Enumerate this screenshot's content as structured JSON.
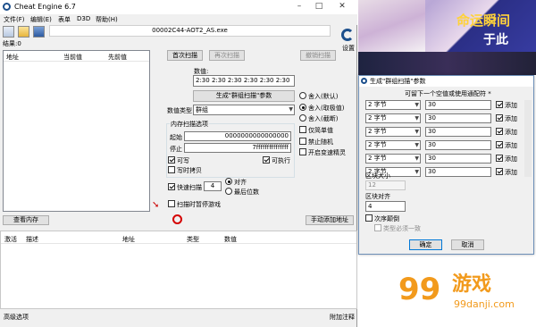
{
  "window": {
    "title": "Cheat Engine 6.7",
    "process": "00002C44-AOT2_AS.exe",
    "found_label": "结果:0"
  },
  "menu": [
    "文件(F)",
    "编辑(E)",
    "表单",
    "D3D",
    "帮助(H)"
  ],
  "results_headers": [
    "地址",
    "当前值",
    "先前值"
  ],
  "buttons": {
    "first_scan": "首次扫描",
    "next_scan": "再次扫描",
    "undo_scan": "撤销扫描",
    "settings": "设置",
    "array_params": "生成\"群组扫描\"参数",
    "view_memory": "查看内存",
    "add_address": "手动添加地址"
  },
  "value": {
    "label": "数值:",
    "text": "2:30 2:30 2:30 2:30 2:30 2:30"
  },
  "value_type": {
    "label": "数值类型",
    "selected": "群组"
  },
  "round_options": [
    "舍入(默认)",
    "舍入(取极值)",
    "舍入(截断)"
  ],
  "extra_options": [
    "仅简单值",
    "禁止随机",
    "开启变速精灵"
  ],
  "memory_options": {
    "title": "内存扫描选项",
    "start_label": "起始",
    "start_value": "0000000000000000",
    "stop_label": "停止",
    "stop_value": "7fffffffffffffff",
    "writable": "可写",
    "executable": "可执行",
    "copy_on_write": "写时拷贝",
    "fast_scan": "快速扫描",
    "fast_scan_value": "4",
    "alignment": "对齐",
    "last_digits": "最后位数",
    "pause_game": "扫描时暂停游戏"
  },
  "address_headers": [
    "激活",
    "描述",
    "地址",
    "类型",
    "数值"
  ],
  "footer": {
    "advanced": "高级选项",
    "comments": "附加注释"
  },
  "dialog": {
    "title": "生成\"群组扫描\"参数",
    "subtitle": "可留下一个空值或使用通配符 *",
    "rows": [
      {
        "type": "2 字节",
        "value": "30",
        "add": "添加"
      },
      {
        "type": "2 字节",
        "value": "30",
        "add": "添加"
      },
      {
        "type": "2 字节",
        "value": "30",
        "add": "添加"
      },
      {
        "type": "2 字节",
        "value": "30",
        "add": "添加"
      },
      {
        "type": "2 字节",
        "value": "30",
        "add": "添加"
      },
      {
        "type": "2 字节",
        "value": "30",
        "add": "添加"
      }
    ],
    "block_size_label": "区块大小",
    "block_size_value": "12",
    "block_align_label": "区块对齐",
    "block_align_value": "4",
    "out_of_order": "次序颠倒",
    "must_be_same_type": "类型必须一致",
    "ok": "确定",
    "cancel": "取消"
  },
  "banner": {
    "text1": "命运瞬间",
    "text2": "于此"
  },
  "watermark": {
    "brand": "游戏",
    "url": "99danji.com"
  }
}
